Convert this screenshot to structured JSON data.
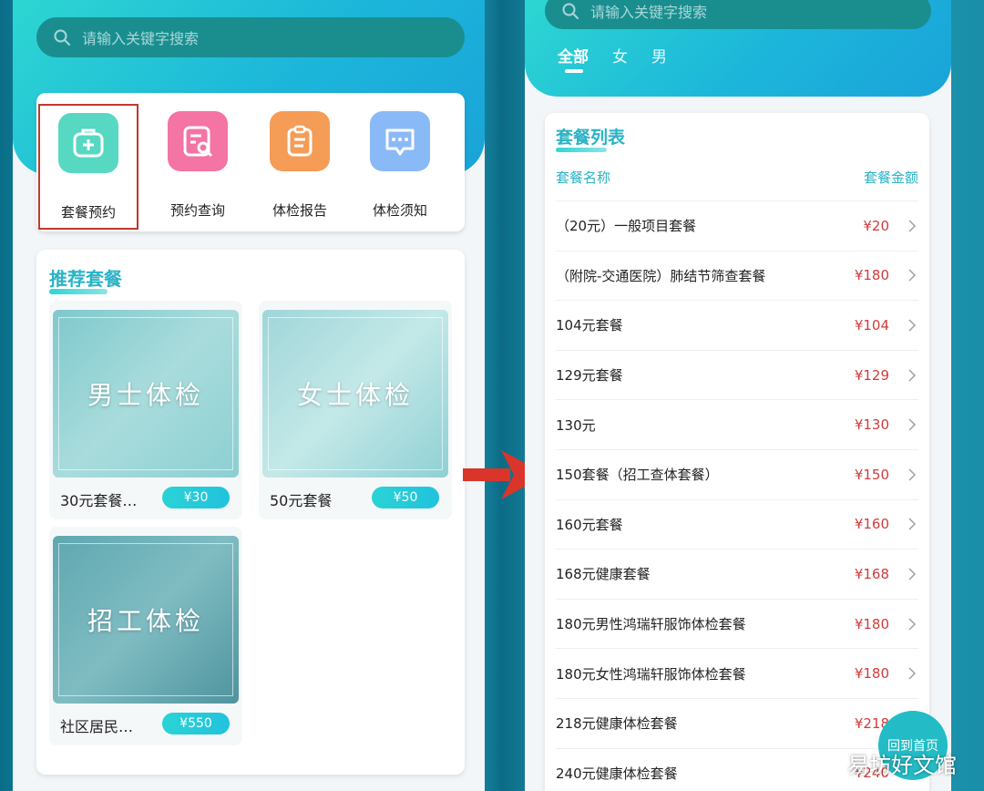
{
  "left": {
    "search_placeholder": "请输入关键字搜索",
    "quick_actions": [
      {
        "label": "套餐预约",
        "color": "#56d8c2",
        "icon": "medkit-icon",
        "selected": true
      },
      {
        "label": "预约查询",
        "color": "#f474a4",
        "icon": "search-document-icon",
        "selected": false
      },
      {
        "label": "体检报告",
        "color": "#f59c57",
        "icon": "clipboard-icon",
        "selected": false
      },
      {
        "label": "体检须知",
        "color": "#8ab9f7",
        "icon": "chat-bubble-icon",
        "selected": false
      }
    ],
    "recommended": {
      "title": "推荐套餐",
      "packages": [
        {
          "image_text": "男士体检",
          "name": "30元套餐…",
          "price": "¥30"
        },
        {
          "image_text": "女士体检",
          "name": "50元套餐",
          "price": "¥50"
        },
        {
          "image_text": "招工体检",
          "name": "社区居民…",
          "price": "¥550"
        }
      ]
    }
  },
  "right": {
    "search_placeholder": "请输入关键字搜索",
    "tabs": [
      {
        "label": "全部",
        "active": true
      },
      {
        "label": "女",
        "active": false
      },
      {
        "label": "男",
        "active": false
      }
    ],
    "list": {
      "title": "套餐列表",
      "col_name": "套餐名称",
      "col_price": "套餐金额",
      "rows": [
        {
          "name": "（20元）一般项目套餐",
          "price": "¥20"
        },
        {
          "name": "（附院-交通医院）肺结节筛查套餐",
          "price": "¥180"
        },
        {
          "name": "104元套餐",
          "price": "¥104"
        },
        {
          "name": "129元套餐",
          "price": "¥129"
        },
        {
          "name": "130元",
          "price": "¥130"
        },
        {
          "name": "150套餐（招工查体套餐）",
          "price": "¥150"
        },
        {
          "name": "160元套餐",
          "price": "¥160"
        },
        {
          "name": "168元健康套餐",
          "price": "¥168"
        },
        {
          "name": "180元男性鸿瑞轩服饰体检套餐",
          "price": "¥180"
        },
        {
          "name": "180元女性鸿瑞轩服饰体检套餐",
          "price": "¥180"
        },
        {
          "name": "218元健康体检套餐",
          "price": "¥218"
        },
        {
          "name": "240元健康体检套餐",
          "price": "¥240"
        }
      ]
    },
    "home_button": "回到首页"
  },
  "watermark": "易坊好文馆",
  "colors": {
    "accent": "#2ab3c6",
    "price_red": "#d23b3b",
    "highlight_box": "#c0392b",
    "arrow_red": "#d9352b"
  }
}
